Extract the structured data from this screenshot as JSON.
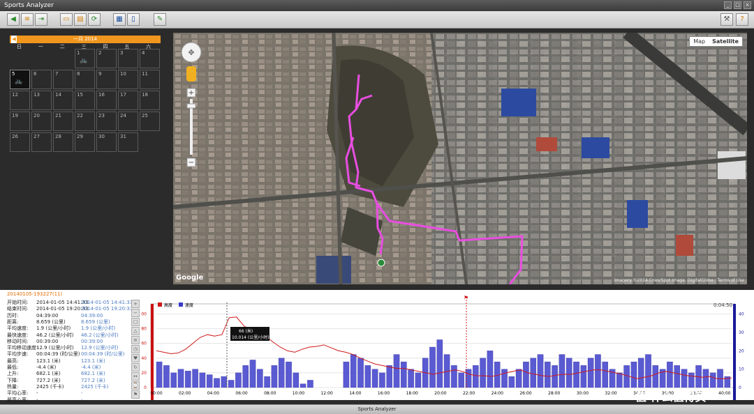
{
  "app": {
    "title": "Sports Analyzer"
  },
  "calendar": {
    "month_label": "一月 2014",
    "weekdays": [
      "日",
      "一",
      "二",
      "三",
      "四",
      "五",
      "六"
    ],
    "days": [
      "",
      "",
      "",
      "1",
      "2",
      "3",
      "4",
      "5",
      "6",
      "7",
      "8",
      "9",
      "10",
      "11",
      "12",
      "13",
      "14",
      "15",
      "16",
      "17",
      "18",
      "19",
      "20",
      "21",
      "22",
      "23",
      "24",
      "25",
      "26",
      "27",
      "28",
      "29",
      "30",
      "31"
    ],
    "active_day": "5",
    "activity_days": [
      "1",
      "5"
    ]
  },
  "map": {
    "map_btn": "Map",
    "satellite_btn": "Satellite",
    "logo": "Google",
    "attribution": "Imagery ©2014 Cnes/Spot Image, DigitalGlobe · Terms of Use"
  },
  "info": {
    "title": "20140105-193227(11)",
    "rows": [
      {
        "label": "开始时间:",
        "v1": "2014-01-05 14:41:33",
        "v2": "2014-01-05 14:41:33"
      },
      {
        "label": "结束时间:",
        "v1": "2014-01-05 19:20:33",
        "v2": "2014-01-05 19:20:33"
      },
      {
        "label": "历时:",
        "v1": "04:39:00",
        "v2": "04:39:00"
      },
      {
        "label": "距离:",
        "v1": "8.659 (公里)",
        "v2": "8.659 (公里)"
      },
      {
        "label": "平均速度:",
        "v1": "1.9 (公里/小时)",
        "v2": "1.9 (公里/小时)"
      },
      {
        "label": "最快速度:",
        "v1": "46.2 (公里/小时)",
        "v2": "46.2 (公里/小时)"
      },
      {
        "label": "移动时间:",
        "v1": "00:39:00",
        "v2": "00:39:00"
      },
      {
        "label": "平均移动速度:",
        "v1": "12.9 (公里/小时)",
        "v2": "12.9 (公里/小时)"
      },
      {
        "label": "平均步速:",
        "v1": "00:04:39 (时/公里)",
        "v2": "00:04:39 (时/公里)"
      },
      {
        "label": "最高:",
        "v1": "123.1 (米)",
        "v2": "123.1 (米)"
      },
      {
        "label": "最低:",
        "v1": "-4.4 (米)",
        "v2": "-4.4 (米)"
      },
      {
        "label": "上升:",
        "v1": "682.1 (米)",
        "v2": "682.1 (米)"
      },
      {
        "label": "下降:",
        "v1": "727.2 (米)",
        "v2": "727.2 (米)"
      },
      {
        "label": "热量:",
        "v1": "2425 (千卡)",
        "v2": "2425 (千卡)"
      },
      {
        "label": "平均心率:",
        "v1": "-",
        "v2": "-"
      },
      {
        "label": "最高心率:",
        "v1": "-",
        "v2": "-"
      }
    ]
  },
  "chart_data": {
    "type": "bar",
    "legend": [
      "高度",
      "速度"
    ],
    "x_ticks": [
      "00:00",
      "02:00",
      "04:00",
      "06:00",
      "08:00",
      "10:00",
      "12:00",
      "14:00",
      "16:00",
      "18:00",
      "20:00",
      "22:00",
      "24:00",
      "26:00",
      "28:00",
      "30:00",
      "32:00",
      "34:00",
      "36:00",
      "38:00",
      "40:00"
    ],
    "y_left_ticks": [
      "0",
      "20",
      "40",
      "60",
      "80",
      "100"
    ],
    "y_right_ticks": [
      "0",
      "10",
      "20",
      "30",
      "40"
    ],
    "ylim_left": [
      0,
      110
    ],
    "ylim_right": [
      0,
      44
    ],
    "xlim": [
      0,
      40.5
    ],
    "duration_label": "0:04:50",
    "tooltip": {
      "altitude": "66 (米)",
      "speed": "10.014 (公里/小时)"
    },
    "altitude": [
      50,
      48,
      46,
      47,
      52,
      60,
      68,
      72,
      70,
      72,
      95,
      96,
      84,
      78,
      72,
      70,
      62,
      55,
      50,
      48,
      52,
      55,
      56,
      58,
      54,
      50,
      48,
      45,
      40,
      36,
      32,
      30,
      28,
      26,
      26,
      24,
      22,
      20,
      18,
      20,
      22,
      24,
      22,
      18,
      16,
      16,
      15,
      17,
      20,
      22,
      24,
      20,
      18,
      16,
      15,
      17,
      18,
      18,
      20,
      22,
      24,
      24,
      22,
      20,
      18,
      15,
      12,
      14,
      16,
      20,
      22,
      20,
      18,
      16,
      15,
      14,
      15,
      12,
      12,
      13
    ],
    "speed": [
      14,
      12,
      8,
      10,
      9,
      10,
      8,
      7,
      5,
      6,
      4,
      8,
      12,
      15,
      10,
      6,
      12,
      16,
      14,
      8,
      2,
      4,
      0,
      0,
      0,
      0,
      14,
      18,
      16,
      12,
      10,
      8,
      12,
      18,
      14,
      10,
      8,
      16,
      22,
      26,
      18,
      12,
      8,
      10,
      12,
      16,
      20,
      14,
      10,
      6,
      10,
      14,
      16,
      18,
      14,
      12,
      18,
      16,
      14,
      12,
      16,
      18,
      14,
      10,
      8,
      12,
      14,
      16,
      18,
      12,
      10,
      14,
      12,
      10,
      8,
      12,
      10,
      8,
      10,
      6
    ]
  },
  "status": {
    "text": "Sports Analyzer"
  },
  "watermark": "值 什么值得买"
}
